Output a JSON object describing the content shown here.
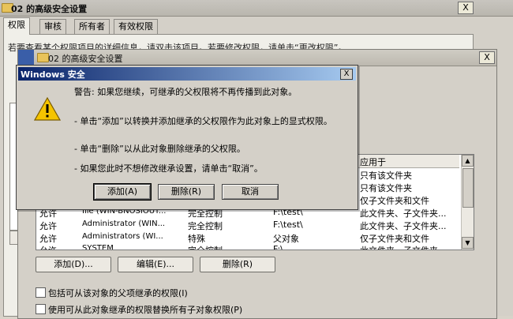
{
  "back_window": {
    "title": "02 的高级安全设置",
    "close_label": "X",
    "tabs": [
      "权限",
      "审核",
      "所有者",
      "有效权限"
    ],
    "description": "若要查看某个权限项目的详细信息，请双击该项目。若要修改权限，请单击“更改权限”。"
  },
  "front_window": {
    "title": "02 的高级安全设置",
    "close_label": "X",
    "list": {
      "header_applies_to": "应用于",
      "rows": [
        {
          "type": "",
          "name": "",
          "permission": "",
          "inherited_from": "",
          "applies_to": "只有该文件夹"
        },
        {
          "type": "",
          "name": "",
          "permission": "",
          "inherited_from": "",
          "applies_to": "只有该文件夹"
        },
        {
          "type": "",
          "name": "",
          "permission": "",
          "inherited_from": "",
          "applies_to": "仅子文件夹和文件"
        },
        {
          "type": "允许",
          "name": "Ille (WIN-BNOSIOUT...",
          "permission": "完全控制",
          "inherited_from": "F:\\test\\",
          "applies_to": "此文件夹、子文件夹..."
        },
        {
          "type": "允许",
          "name": "Administrator (WIN...",
          "permission": "完全控制",
          "inherited_from": "F:\\test\\",
          "applies_to": "此文件夹、子文件夹..."
        },
        {
          "type": "允许",
          "name": "Administrators (WI...",
          "permission": "特殊",
          "inherited_from": "父对象",
          "applies_to": "仅子文件夹和文件"
        },
        {
          "type": "允许",
          "name": "SYSTEM",
          "permission": "完全控制",
          "inherited_from": "F:\\",
          "applies_to": "此文件夹、子文件夹..."
        }
      ]
    },
    "buttons": {
      "add": "添加(D)...",
      "edit": "编辑(E)...",
      "remove": "删除(R)"
    },
    "checkbox_inherit": "包括可从该对象的父项继承的权限(I)",
    "checkbox_replace": "使用可从此对象继承的权限替换所有子对象权限(P)"
  },
  "dialog": {
    "title": "Windows 安全",
    "close_label": "X",
    "warning": "警告: 如果您继续，可继承的父权限将不再传播到此对象。",
    "bullet_add": "- 单击“添加”以转换并添加继承的父权限作为此对象上的显式权限。",
    "bullet_remove": "- 单击“删除”以从此对象删除继承的父权限。",
    "bullet_cancel": "- 如果您此时不想修改继承设置，请单击“取消”。",
    "btn_add": "添加(A)",
    "btn_remove": "删除(R)",
    "btn_cancel": "取消",
    "icon": "warning-icon"
  },
  "colors": {
    "dialog_title_start": "#0a246a",
    "dialog_title_end": "#a6caf0",
    "window_face": "#d4d0c8"
  }
}
